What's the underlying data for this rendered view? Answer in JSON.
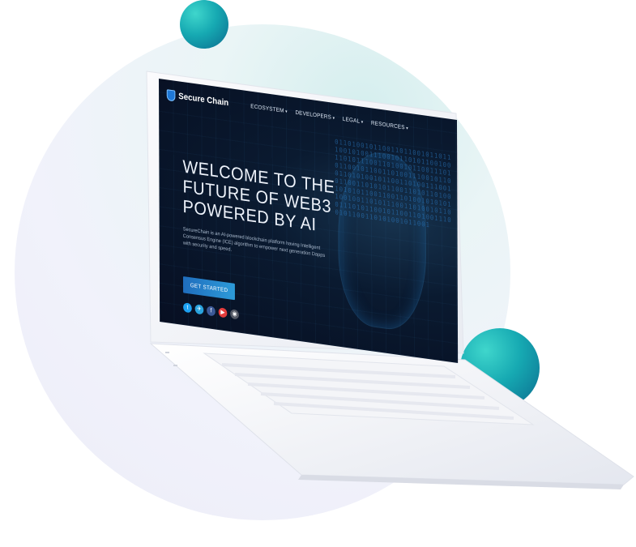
{
  "illustration": {
    "accent_colors": {
      "teal": "#16a9b2",
      "deep_blue": "#0b6b8e",
      "backdrop": "#eaf5f6"
    }
  },
  "site": {
    "brand": "Secure Chain",
    "nav": {
      "items": [
        "ECOSYSTEM",
        "DEVELOPERS",
        "LEGAL",
        "RESOURCES"
      ]
    },
    "hero": {
      "title_line1": "WELCOME TO THE",
      "title_line2": "FUTURE OF WEB3",
      "title_line3": "POWERED BY AI",
      "description": "SecureChain is an AI-powered blockchain platform having Intelligent Consensus Engine (ICE) algorithm to empower next generation Dapps with security and speed.",
      "cta_label": "GET STARTED"
    },
    "socials": [
      {
        "icon": "twitter-icon",
        "glyph": "t",
        "color": "#1da1f2"
      },
      {
        "icon": "telegram-icon",
        "glyph": "✈",
        "color": "#2aa3de"
      },
      {
        "icon": "facebook-icon",
        "glyph": "f",
        "color": "#3b5998"
      },
      {
        "icon": "youtube-icon",
        "glyph": "▶",
        "color": "#e43c3c"
      },
      {
        "icon": "github-icon",
        "glyph": "◉",
        "color": "#555a66"
      }
    ],
    "code_rain": "0110100101100110110010110111001010011100101101011001001101011100110100101100111010110010110011010011100101100110101001011001101001110010110011010101100110101101001010101100110011010010101011001001101011100110100101100111010110010110011010011100101100110101001011001"
  }
}
